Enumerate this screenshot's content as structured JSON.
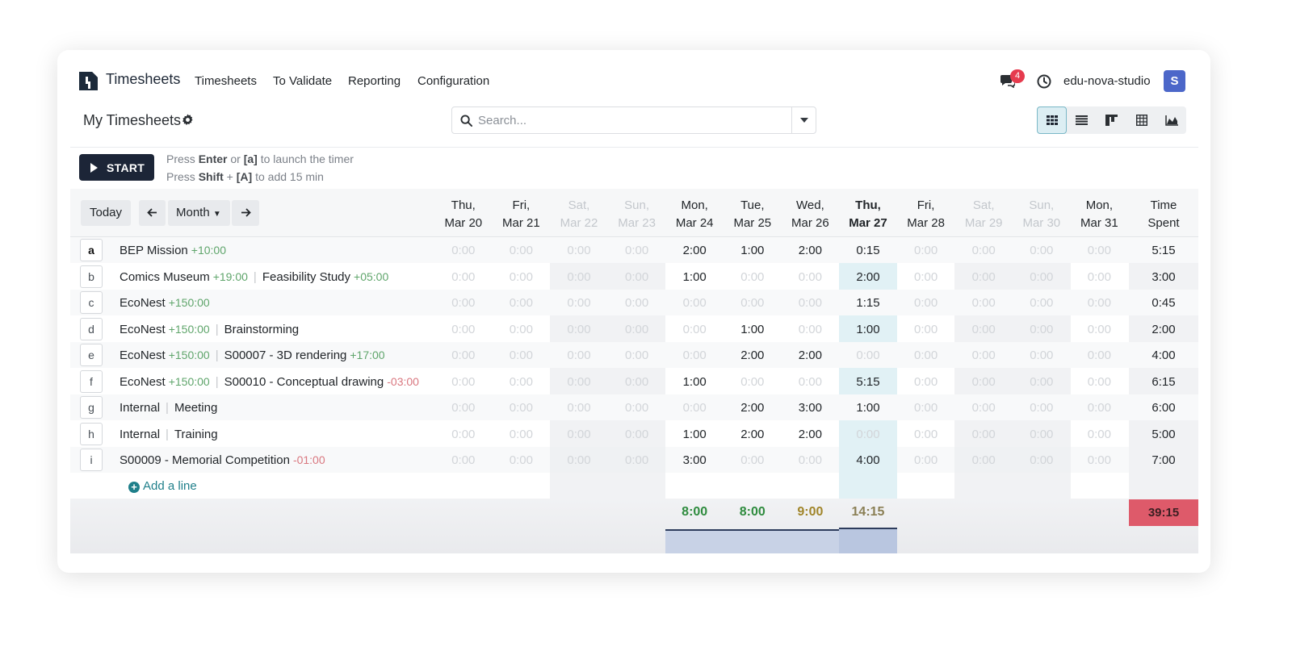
{
  "navbar": {
    "app_title": "Timesheets",
    "menu": [
      "Timesheets",
      "To Validate",
      "Reporting",
      "Configuration"
    ],
    "messages_badge": "4",
    "user_name": "edu-nova-studio",
    "avatar_initial": "S"
  },
  "control_panel": {
    "title": "My Timesheets",
    "search_placeholder": "Search...",
    "views": [
      "grid-icon",
      "list-icon",
      "kanban-icon",
      "pivot-icon",
      "graph-icon"
    ]
  },
  "timer": {
    "start_label": "START",
    "hint1": {
      "pre": "Press ",
      "key1": "Enter",
      "mid": " or ",
      "key2": "[a]",
      "post": " to launch the timer"
    },
    "hint2": {
      "pre": "Press ",
      "key1": "Shift",
      "mid": " + ",
      "key2": "[A]",
      "post": " to add 15 min"
    }
  },
  "grid_nav": {
    "today": "Today",
    "range": "Month",
    "prev_icon": "arrow-left-icon",
    "next_icon": "arrow-right-icon"
  },
  "days": [
    {
      "line1": "Thu,",
      "line2": "Mar 20",
      "weekend": false,
      "today": false
    },
    {
      "line1": "Fri,",
      "line2": "Mar 21",
      "weekend": false,
      "today": false
    },
    {
      "line1": "Sat,",
      "line2": "Mar 22",
      "weekend": true,
      "today": false
    },
    {
      "line1": "Sun,",
      "line2": "Mar 23",
      "weekend": true,
      "today": false
    },
    {
      "line1": "Mon,",
      "line2": "Mar 24",
      "weekend": false,
      "today": false
    },
    {
      "line1": "Tue,",
      "line2": "Mar 25",
      "weekend": false,
      "today": false
    },
    {
      "line1": "Wed,",
      "line2": "Mar 26",
      "weekend": false,
      "today": false
    },
    {
      "line1": "Thu,",
      "line2": "Mar 27",
      "weekend": false,
      "today": true
    },
    {
      "line1": "Fri,",
      "line2": "Mar 28",
      "weekend": false,
      "today": false
    },
    {
      "line1": "Sat,",
      "line2": "Mar 29",
      "weekend": true,
      "today": false
    },
    {
      "line1": "Sun,",
      "line2": "Mar 30",
      "weekend": true,
      "today": false
    },
    {
      "line1": "Mon,",
      "line2": "Mar 31",
      "weekend": false,
      "today": false
    }
  ],
  "total_header": {
    "line1": "Time",
    "line2": "Spent"
  },
  "rows": [
    {
      "key": "a",
      "project": "BEP Mission",
      "project_delta": "+10:00",
      "task": "",
      "task_delta": "",
      "cells": [
        "0:00",
        "0:00",
        "0:00",
        "0:00",
        "2:00",
        "1:00",
        "2:00",
        "0:15",
        "0:00",
        "0:00",
        "0:00",
        "0:00"
      ],
      "total": "5:15"
    },
    {
      "key": "b",
      "project": "Comics Museum",
      "project_delta": "+19:00",
      "task": "Feasibility Study",
      "task_delta": "+05:00",
      "cells": [
        "0:00",
        "0:00",
        "0:00",
        "0:00",
        "1:00",
        "0:00",
        "0:00",
        "2:00",
        "0:00",
        "0:00",
        "0:00",
        "0:00"
      ],
      "total": "3:00"
    },
    {
      "key": "c",
      "project": "EcoNest",
      "project_delta": "+150:00",
      "task": "",
      "task_delta": "",
      "cells": [
        "0:00",
        "0:00",
        "0:00",
        "0:00",
        "0:00",
        "0:00",
        "0:00",
        "1:15",
        "0:00",
        "0:00",
        "0:00",
        "0:00"
      ],
      "total": "0:45"
    },
    {
      "key": "d",
      "project": "EcoNest",
      "project_delta": "+150:00",
      "task": "Brainstorming",
      "task_delta": "",
      "cells": [
        "0:00",
        "0:00",
        "0:00",
        "0:00",
        "0:00",
        "1:00",
        "0:00",
        "1:00",
        "0:00",
        "0:00",
        "0:00",
        "0:00"
      ],
      "total": "2:00"
    },
    {
      "key": "e",
      "project": "EcoNest",
      "project_delta": "+150:00",
      "task": "S00007 - 3D rendering",
      "task_delta": "+17:00",
      "cells": [
        "0:00",
        "0:00",
        "0:00",
        "0:00",
        "0:00",
        "2:00",
        "2:00",
        "0:00",
        "0:00",
        "0:00",
        "0:00",
        "0:00"
      ],
      "total": "4:00"
    },
    {
      "key": "f",
      "project": "EcoNest",
      "project_delta": "+150:00",
      "task": "S00010 - Conceptual drawing",
      "task_delta": "-03:00",
      "cells": [
        "0:00",
        "0:00",
        "0:00",
        "0:00",
        "1:00",
        "0:00",
        "0:00",
        "5:15",
        "0:00",
        "0:00",
        "0:00",
        "0:00"
      ],
      "total": "6:15"
    },
    {
      "key": "g",
      "project": "Internal",
      "project_delta": "",
      "task": "Meeting",
      "task_delta": "",
      "cells": [
        "0:00",
        "0:00",
        "0:00",
        "0:00",
        "0:00",
        "2:00",
        "3:00",
        "1:00",
        "0:00",
        "0:00",
        "0:00",
        "0:00"
      ],
      "total": "6:00"
    },
    {
      "key": "h",
      "project": "Internal",
      "project_delta": "",
      "task": "Training",
      "task_delta": "",
      "cells": [
        "0:00",
        "0:00",
        "0:00",
        "0:00",
        "1:00",
        "2:00",
        "2:00",
        "0:00",
        "0:00",
        "0:00",
        "0:00",
        "0:00"
      ],
      "total": "5:00"
    },
    {
      "key": "i",
      "project": "S00009 - Memorial Competition",
      "project_delta": "-01:00",
      "task": "",
      "task_delta": "",
      "cells": [
        "0:00",
        "0:00",
        "0:00",
        "0:00",
        "3:00",
        "0:00",
        "0:00",
        "4:00",
        "0:00",
        "0:00",
        "0:00",
        "0:00"
      ],
      "total": "7:00"
    }
  ],
  "add_line": "Add a line",
  "day_totals": [
    "",
    "",
    "",
    "",
    "8:00",
    "8:00",
    "9:00",
    "14:15",
    "",
    "",
    "",
    ""
  ],
  "day_total_colors": [
    "",
    "",
    "",
    "",
    "#2e8b3e",
    "#2e8b3e",
    "#a0852a",
    "#8a7f55",
    "",
    "",
    "",
    ""
  ],
  "grand_total": "39:15",
  "colors": {
    "today_column": "#dff0f3",
    "weekend_column": "#eceef0",
    "grand_total_bg": "#de5a6a",
    "start_button": "#1c2537"
  }
}
